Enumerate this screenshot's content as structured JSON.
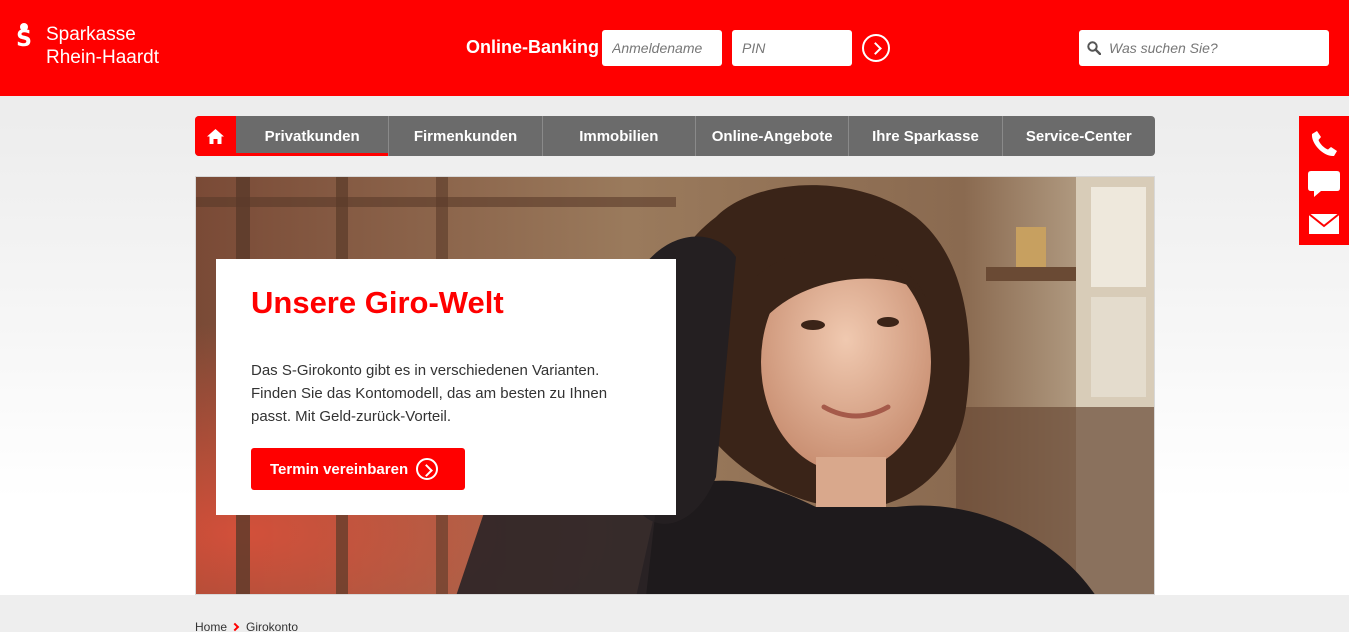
{
  "brand": {
    "line1": "Sparkasse",
    "line2": "Rhein-Haardt",
    "color": "#ff0000",
    "logo_icon": "sparkasse-s-logo"
  },
  "login": {
    "label": "Online-Banking",
    "username_placeholder": "Anmeldename",
    "pin_placeholder": "PIN",
    "submit_icon": "chevron-right-circle-icon"
  },
  "search": {
    "placeholder": "Was suchen Sie?",
    "icon": "search-icon"
  },
  "nav": {
    "home_icon": "home-icon",
    "items": [
      {
        "label": "Privatkunden",
        "active": true
      },
      {
        "label": "Firmenkunden",
        "active": false
      },
      {
        "label": "Immobilien",
        "active": false
      },
      {
        "label": "Online-Angebote",
        "active": false
      },
      {
        "label": "Ihre Sparkasse",
        "active": false
      },
      {
        "label": "Service-Center",
        "active": false
      }
    ]
  },
  "contact_bar": {
    "icons": [
      "phone-icon",
      "chat-icon",
      "mail-icon"
    ]
  },
  "hero": {
    "title": "Unsere Giro-Welt",
    "text": "Das S-Girokonto gibt es in verschiedenen Varianten. Finden Sie das Kontomodell, das am besten zu Ihnen passt. Mit Geld-zurück-Vorteil.",
    "cta_label": "Termin vereinbaren",
    "image": "woman-smiling-photo"
  },
  "breadcrumb": {
    "home": "Home",
    "current": "Girokonto"
  }
}
